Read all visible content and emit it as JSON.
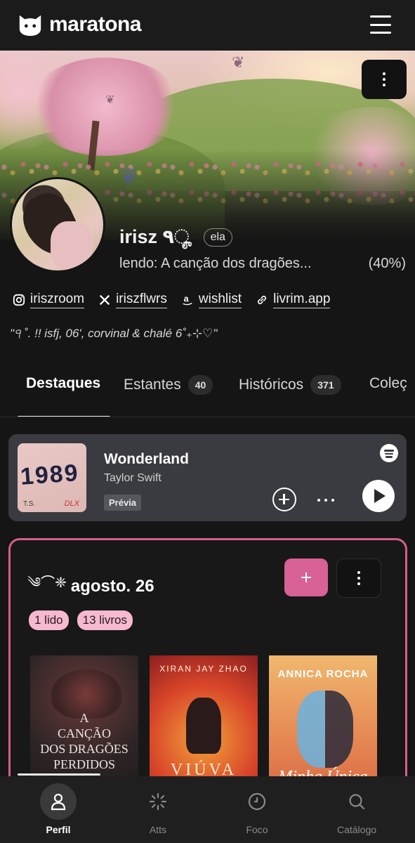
{
  "app": {
    "name": "maratona"
  },
  "profile": {
    "name": "irisz ٩ೄ",
    "pronoun": "ela",
    "reading_label": "lendo: A canção dos dragões...",
    "reading_progress": "(40%)",
    "links": [
      {
        "icon": "instagram-icon",
        "label": "iriszroom"
      },
      {
        "icon": "x-icon",
        "label": "iriszflwrs"
      },
      {
        "icon": "amazon-icon",
        "label": "wishlist"
      },
      {
        "icon": "link-icon",
        "label": "livrim.app"
      }
    ],
    "bio": "\"੧ ˚. !! isfj, 06', corvinal & chalé 6˚₊⊹♡\""
  },
  "tabs": [
    {
      "label": "Destaques",
      "active": true
    },
    {
      "label": "Estantes",
      "count": "40"
    },
    {
      "label": "Históricos",
      "count": "371"
    },
    {
      "label": "Coleç"
    }
  ],
  "music": {
    "track": "Wonderland",
    "artist": "Taylor Swift",
    "preview_label": "Prévia",
    "album_text": "1989",
    "album_initials": "T.S.",
    "album_edition": "DLX"
  },
  "collection": {
    "ornament": "༄⌒❈",
    "title": "agosto. 26",
    "pills": [
      "1 lido",
      "13 livros"
    ],
    "books": [
      {
        "title_line1": "A",
        "title_line2": "CANÇÃO",
        "title_line3": "DOS DRAGÕES",
        "title_line4": "PERDIDOS"
      },
      {
        "author": "XIRAN JAY ZHAO",
        "title": "VIÚVA"
      },
      {
        "author": "ANNICA ROCHA",
        "title": "Minha Única"
      }
    ]
  },
  "bottom_nav": [
    {
      "label": "Perfil",
      "icon": "person-icon",
      "active": true
    },
    {
      "label": "Atts",
      "icon": "loader-icon"
    },
    {
      "label": "Foco",
      "icon": "clock-icon"
    },
    {
      "label": "Catálogo",
      "icon": "search-icon"
    }
  ],
  "colors": {
    "accent": "#d86196",
    "pill": "#f6b9cf",
    "background": "#151515"
  }
}
